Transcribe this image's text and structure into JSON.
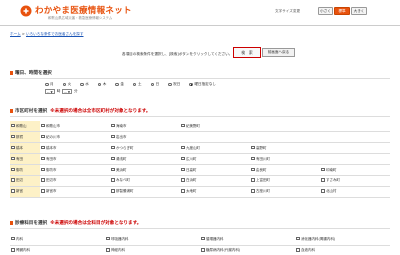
{
  "header": {
    "logo_main": "わかやま医療情報ネット",
    "logo_sub": "和歌山県広域災害・救急医療情報システム",
    "font_size_label": "文字サイズ変更",
    "font_size_buttons": [
      "小さく",
      "標準",
      "大きく"
    ],
    "accent": "#e8520e"
  },
  "breadcrumb": {
    "home": "ホーム",
    "separator": " > ",
    "current": "いろいろな条件でお医者さんを探す"
  },
  "instruction": "各項目の検索条件を選択し、[検索]ボタンをクリックしてください。",
  "buttons": {
    "search": "検　索",
    "back": "前画面へ戻る"
  },
  "sections": {
    "day_time": "曜日、時間を選択",
    "city": "市区町村を選択",
    "city_note": "※未選択の場合は全市区町村が対象となります。",
    "dept": "診療科目を選択",
    "dept_note": "※未選択の場合は全科目が対象となります。"
  },
  "days": [
    "月",
    "火",
    "水",
    "木",
    "金",
    "土",
    "日",
    "祝日",
    "曜日指定なし"
  ],
  "time": {
    "hour": "--",
    "hour_unit": "時",
    "minute": "--",
    "minute_unit": "分"
  },
  "city_rows": [
    {
      "area": "和歌山",
      "cities": [
        "和歌山市",
        "海南市",
        "紀美野町"
      ]
    },
    {
      "area": "那賀",
      "cities": [
        "紀の川市",
        "岩出市"
      ]
    },
    {
      "area": "橋本",
      "cities": [
        "橋本市",
        "かつらぎ町",
        "九度山町",
        "高野町"
      ]
    },
    {
      "area": "有田",
      "cities": [
        "有田市",
        "湯浅町",
        "広川町",
        "有田川町"
      ]
    },
    {
      "area": "御坊",
      "cities": [
        "御坊市",
        "美浜町",
        "日高町",
        "由良町",
        "印南町",
        "日高川町"
      ]
    },
    {
      "area": "田辺",
      "cities": [
        "田辺市",
        "みなべ町",
        "白浜町",
        "上富田町",
        "すさみ町"
      ]
    },
    {
      "area": "新宮",
      "cities": [
        "新宮市",
        "那智勝浦町",
        "太地町",
        "古座川町",
        "北山村",
        "串本町"
      ]
    }
  ],
  "departments": [
    [
      "内科",
      "呼吸器内科",
      "循環器内科",
      "消化器内科(胃腸内科)"
    ],
    [
      "腎臓内科",
      "神経内科",
      "糖尿病内科(代謝内科)",
      "血液内科"
    ]
  ]
}
